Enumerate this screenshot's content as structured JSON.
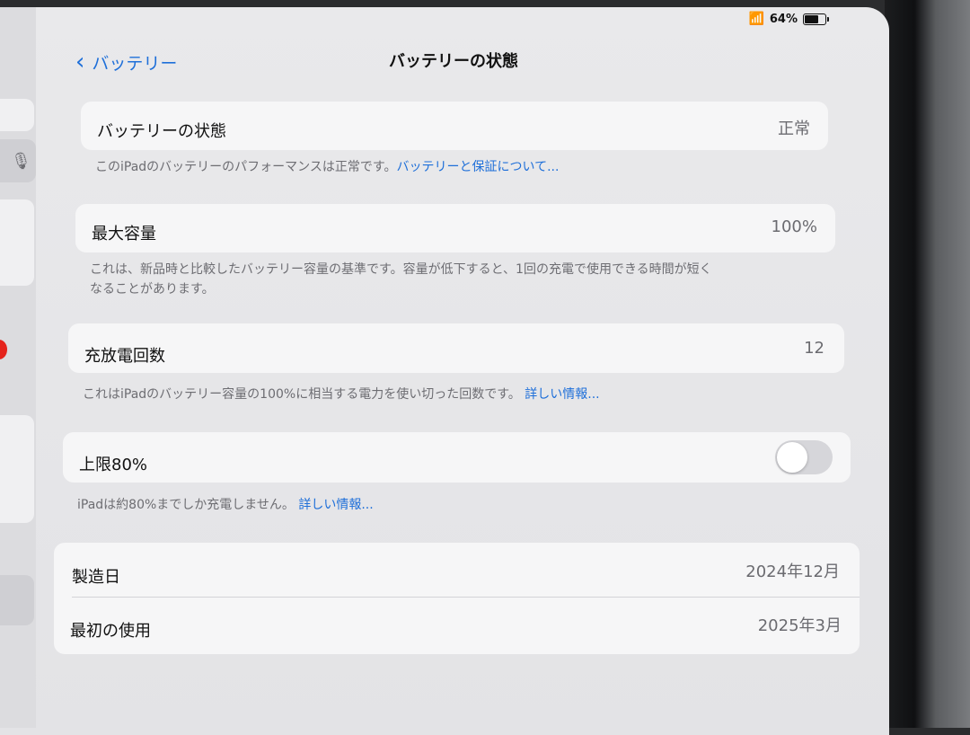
{
  "status_bar": {
    "battery_percent": "64%",
    "battery_level": 0.64
  },
  "nav": {
    "back_label": "バッテリー",
    "title": "バッテリーの状態"
  },
  "health": {
    "label": "バッテリーの状態",
    "value": "正常",
    "footer_text": "このiPadのバッテリーのパフォーマンスは正常です。",
    "footer_link": "バッテリーと保証について..."
  },
  "capacity": {
    "label": "最大容量",
    "value": "100%",
    "footer_line1": "これは、新品時と比較したバッテリー容量の基準です。容量が低下すると、1回の充電で使用できる時間が短く",
    "footer_line2": "なることがあります。"
  },
  "cycles": {
    "label": "充放電回数",
    "value": "12",
    "footer_text": "これはiPadのバッテリー容量の100%に相当する電力を使い切った回数です。",
    "footer_link": "詳しい情報..."
  },
  "limit": {
    "label": "上限80%",
    "toggle_on": false,
    "footer_text": "iPadは約80%までしか充電しません。",
    "footer_link": "詳しい情報..."
  },
  "dates": {
    "manufacture_label": "製造日",
    "manufacture_value": "2024年12月",
    "first_use_label": "最初の使用",
    "first_use_value": "2025年3月"
  }
}
